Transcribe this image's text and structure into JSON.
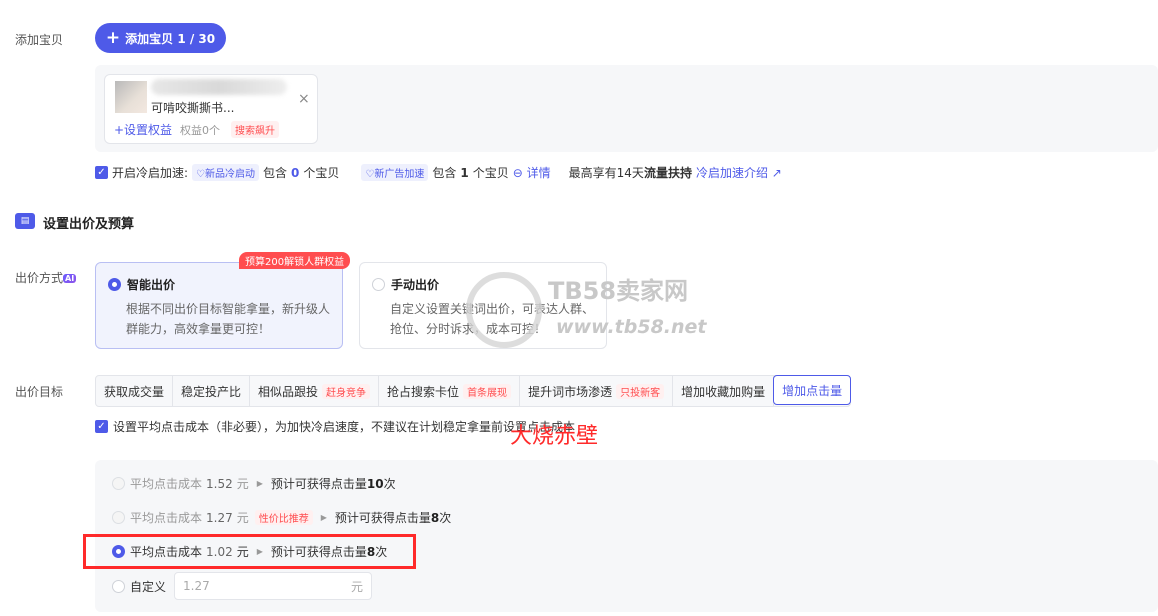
{
  "add_item": {
    "label": "添加宝贝",
    "button": "添加宝贝 1 / 30"
  },
  "product": {
    "title_fragment": "可啃咬撕撕书...",
    "set_rights": "+设置权益",
    "rights_count": "权益0个",
    "tag": "搜索飙升",
    "close": "×"
  },
  "cold_start": {
    "check_label": "开启冷启加速:",
    "pill1": "新品冷启动",
    "text1_a": "包含",
    "count1": "0",
    "text1_b": "个宝贝",
    "pill2": "新广告加速",
    "text2_a": "包含",
    "count2": "1",
    "text2_b": "个宝贝",
    "detail": "详情",
    "max_text": "最高享有14天",
    "traffic": "流量扶持",
    "intro_link": "冷启加速介绍"
  },
  "section": {
    "title": "设置出价及预算"
  },
  "bid_method": {
    "label": "出价方式",
    "ai": "AI",
    "promo": "预算200解锁人群权益",
    "smart": {
      "title": "智能出价",
      "desc": "根据不同出价目标智能拿量，新升级人群能力，高效拿量更可控！"
    },
    "manual": {
      "title": "手动出价",
      "desc": "自定义设置关键词出价，可表达人群、抢位、分时诉求，成本可控！"
    }
  },
  "bid_goal": {
    "label": "出价目标",
    "tabs": [
      {
        "label": "获取成交量",
        "tag": ""
      },
      {
        "label": "稳定投产比",
        "tag": ""
      },
      {
        "label": "相似品跟投",
        "tag": "赶身竞争"
      },
      {
        "label": "抢占搜索卡位",
        "tag": "首条展现"
      },
      {
        "label": "提升词市场渗透",
        "tag": "只投新客"
      },
      {
        "label": "增加收藏加购量",
        "tag": ""
      },
      {
        "label": "增加点击量",
        "tag": ""
      }
    ],
    "avg_cost_check": "设置平均点击成本（非必要），为加快冷启速度，不建议在计划稳定拿量前设置点击成本"
  },
  "options": [
    {
      "label": "平均点击成本",
      "value": "1.52",
      "unit": "元",
      "tag": "",
      "est_prefix": "预计可获得点击量",
      "est_value": "10",
      "est_unit": "次"
    },
    {
      "label": "平均点击成本",
      "value": "1.27",
      "unit": "元",
      "tag": "性价比推荐",
      "est_prefix": "预计可获得点击量",
      "est_value": "8",
      "est_unit": "次"
    },
    {
      "label": "平均点击成本",
      "value": "1.02",
      "unit": "元",
      "tag": "",
      "est_prefix": "预计可获得点击量",
      "est_value": "8",
      "est_unit": "次"
    }
  ],
  "custom": {
    "label": "自定义",
    "placeholder": "1.27",
    "unit": "元"
  },
  "watermarks": {
    "red": "大烧赤壁",
    "site_name": "TB58卖家网",
    "site_url": "www.tb58.net"
  },
  "colors": {
    "primary": "#4e5ae8",
    "danger": "#ff4d4f",
    "highlight_box": "#ff2a2a"
  }
}
